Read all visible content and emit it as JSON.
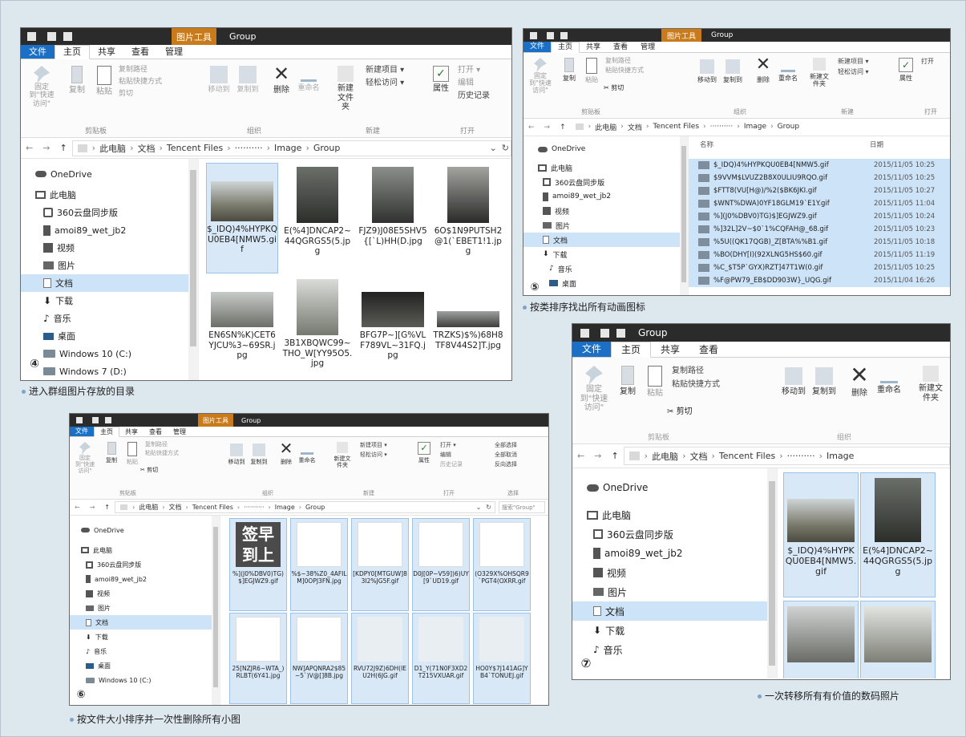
{
  "common": {
    "tool_tab": "图片工具",
    "ribbon": {
      "pin": "固定到\"快速访问\"",
      "copy": "复制",
      "paste": "粘贴",
      "copy_path": "复制路径",
      "paste_shortcut": "粘贴快捷方式",
      "cut": "剪切",
      "move_to": "移动到",
      "copy_to": "复制到",
      "delete": "删除",
      "rename": "重命名",
      "new_folder": "新建文件夹",
      "new_item": "新建项目",
      "easy_access": "轻松访问",
      "properties": "属性",
      "open": "打开",
      "edit": "编辑",
      "history": "历史记录",
      "select_all": "全部选择",
      "select_none": "全部取消",
      "invert": "反向选择",
      "g_clipboard": "剪贴板",
      "g_organize": "组织",
      "g_new": "新建",
      "g_open": "打开",
      "g_select": "选择"
    },
    "crumbs": [
      "此电脑",
      "文档",
      "Tencent Files",
      "Image",
      "Group"
    ],
    "obscured_crumb": "··········",
    "search_placeholder": "搜索\"Group\"",
    "sidebar": {
      "onedrive": "OneDrive",
      "thispc": "此电脑",
      "sync": "360云盘同步版",
      "phone": "amoi89_wet_jb2",
      "video": "视频",
      "pictures": "图片",
      "documents": "文档",
      "downloads": "下载",
      "music": "音乐",
      "desktop": "桌面",
      "win10": "Windows 10 (C:)",
      "win7": "Windows 7 (D:)"
    }
  },
  "w4": {
    "title": "Group",
    "tabs": [
      "文件",
      "主页",
      "共享",
      "查看",
      "管理"
    ],
    "number": "④",
    "caption": "进入群组图片存放的目录",
    "tiles": [
      "$_IDQ)4%HYPKQU0EB4[NMW5.gif",
      "E(%4]DNCAP2~44QGRGS5(5.jpg",
      "FJZ9)J08E5SHV5{[`L)HH(D.jpg",
      "6O$1N9PUTSH2@1(`EBET1!1.jpg",
      "EN6SN%K)CET6YJCU%3~69SR.jpg",
      "3B1XBQWC99~THO_W[YY95O5.jpg",
      "BFG7P~][G%VLF789VL~31FQ.jpg",
      "TRZKS)$%)68H8TF8V44S2]T.jpg"
    ]
  },
  "w5": {
    "title": "Group",
    "tabs": [
      "文件",
      "主页",
      "共享",
      "查看",
      "管理"
    ],
    "number": "⑤",
    "caption": "按类排序找出所有动画图标",
    "col_name": "名称",
    "col_date": "日期",
    "rows": [
      {
        "name": "$_IDQ)4%HYPKQU0EB4[NMW5.gif",
        "date": "2015/11/05 10:25"
      },
      {
        "name": "$9VVM$LVUZ2B8X0ULIU9RQO.gif",
        "date": "2015/11/05 10:25"
      },
      {
        "name": "$FTT8(VU[H@)/%2($BK6JKI.gif",
        "date": "2015/11/05 10:27"
      },
      {
        "name": "$WNT%DWA)0YF18GLM19`E1Y.gif",
        "date": "2015/11/05 11:04"
      },
      {
        "name": "%](J0%DBV0)TG)$]EGJWZ9.gif",
        "date": "2015/11/05 10:24"
      },
      {
        "name": "%]32L]2V~$0`1%CQFAH@_68.gif",
        "date": "2015/11/05 10:23"
      },
      {
        "name": "%5U((QK17QGB)_Z[BTA%%B1.gif",
        "date": "2015/11/05 10:18"
      },
      {
        "name": "%BO(DHY[I)(92XLNG5HS$60.gif",
        "date": "2015/11/05 11:19"
      },
      {
        "name": "%C_$T5P`GYX)RZT]47T1W(0.gif",
        "date": "2015/11/05 10:25"
      },
      {
        "name": "%F@PW79_EB$DD903W}_UQG.gif",
        "date": "2015/11/04 16:26"
      }
    ]
  },
  "w6": {
    "title": "Group",
    "tabs": [
      "文件",
      "主页",
      "共享",
      "查看",
      "管理"
    ],
    "number": "⑥",
    "caption": "按文件大小排序并一次性删除所有小图",
    "sticker_text": "签早到上",
    "tiles": [
      "%](J0%DBV0)TG)$]EGJWZ9.gif",
      "%$~38%Z0_4AFILM]0OPJ3FN.jpg",
      "[KDPY0[MTGUW]83I2%JG5F.gif",
      "D0J[0P~V59])6)UY[9`UD19.gif",
      "(O329X%OHSQR9`PGT4(OXRR.gif",
      "25[NZJR6~WTA_)RLBT(6Y41.jpg",
      "NW]APQNRA2$85~5`)V@[]8B.jpg",
      "RVU72J9Z)6DH(IEU2H(6JG.gif",
      "D1_Y(71N0F3XD2T215VXUAR.gif",
      "HO0Y$7J141AG]YB4`TONUEJ.gif"
    ]
  },
  "w7": {
    "title": "Group",
    "tabs": [
      "文件",
      "主页",
      "共享",
      "查看"
    ],
    "number": "⑦",
    "caption": "一次转移所有有价值的数码照片",
    "tiles": [
      "$_IDQ)4%HYPKQU0EB4[NMW5.gif",
      "E(%4]DNCAP2~44QGRGS5(5.jpg"
    ]
  }
}
